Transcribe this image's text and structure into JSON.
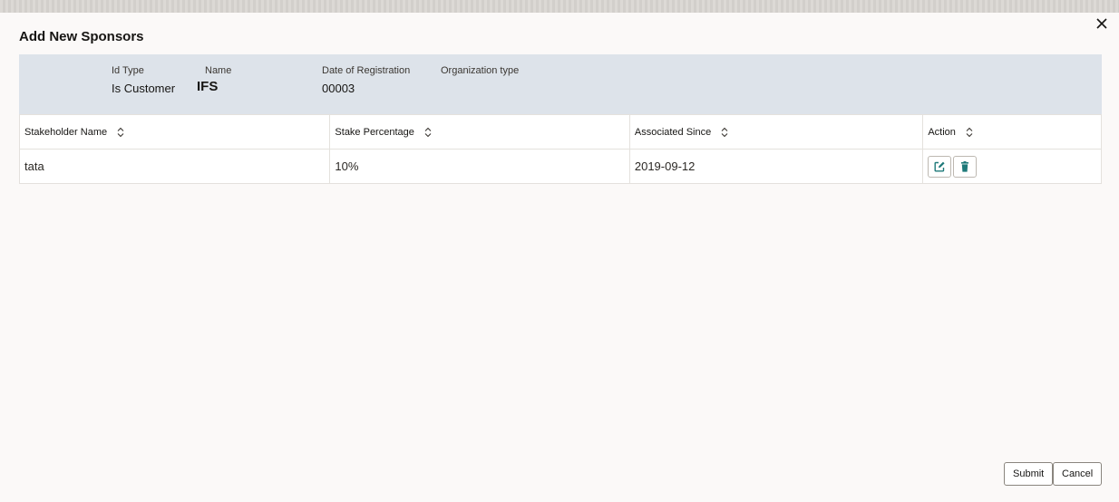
{
  "dialog": {
    "title": "Add New Sponsors"
  },
  "summary": {
    "id_type_label": "Id Type",
    "id_type_value": "Is Customer",
    "name_label": "Name",
    "name_value": "IFS",
    "date_label": "Date of Registration",
    "date_value": "00003",
    "org_label": "Organization type"
  },
  "table": {
    "headers": [
      "Stakeholder Name",
      "Stake Percentage",
      "Associated Since",
      "Action"
    ],
    "rows": [
      {
        "name": "tata",
        "percentage": "10%",
        "since": "2019-09-12"
      }
    ]
  },
  "footer": {
    "submit_label": "Submit",
    "cancel_label": "Cancel"
  },
  "colors": {
    "accent": "#1f7a7a",
    "summary_bg": "#dde3ea"
  },
  "icons": [
    "close-icon",
    "sort-icon",
    "edit-icon",
    "trash-icon"
  ]
}
